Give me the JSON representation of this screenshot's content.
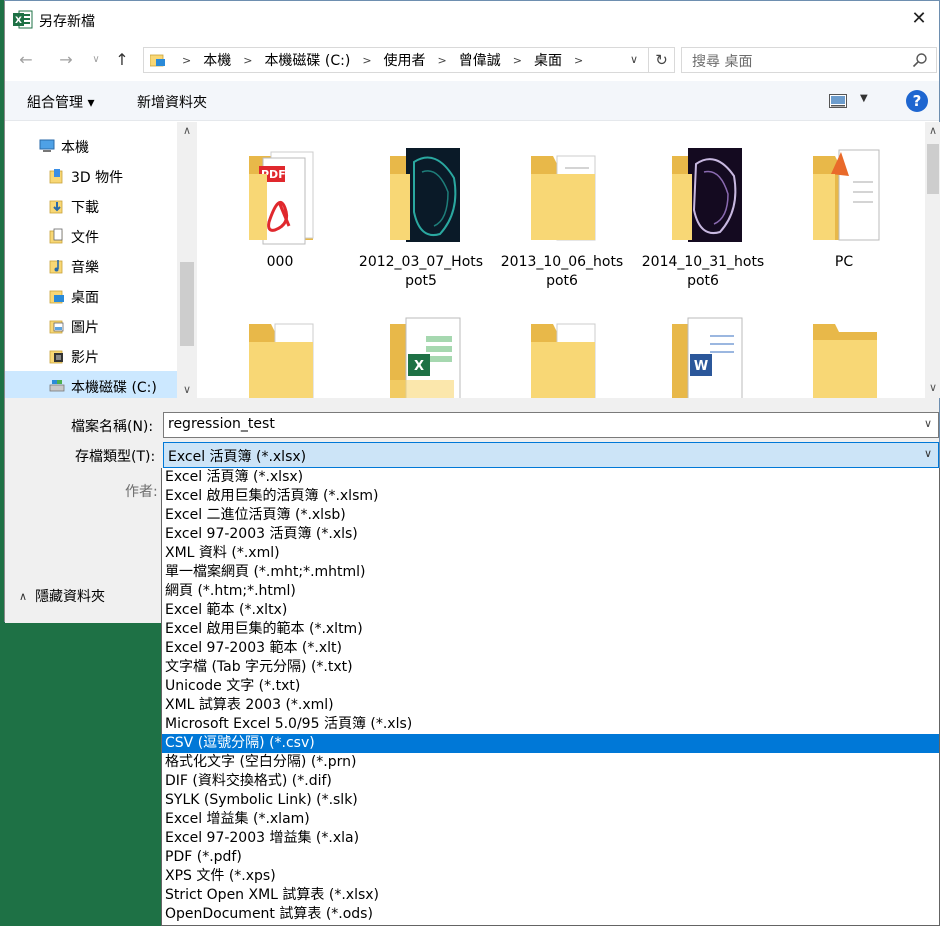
{
  "window": {
    "title": "另存新檔"
  },
  "colors": {
    "accent": "#0078d7",
    "excel_green": "#1e7145",
    "folder": "#f8d775",
    "help_blue": "#1e66d0"
  },
  "address": {
    "crumbs": [
      "本機",
      "本機磁碟 (C:)",
      "使用者",
      "曾偉誠",
      "桌面"
    ],
    "search_placeholder": "搜尋 桌面"
  },
  "toolbar": {
    "organize": "組合管理 ▾",
    "new_folder": "新增資料夾",
    "help": "?"
  },
  "nav": {
    "items": [
      {
        "label": "本機",
        "icon": "computer-icon"
      },
      {
        "label": "3D 物件",
        "icon": "3d-objects-icon"
      },
      {
        "label": "下載",
        "icon": "downloads-icon"
      },
      {
        "label": "文件",
        "icon": "documents-icon"
      },
      {
        "label": "音樂",
        "icon": "music-icon"
      },
      {
        "label": "桌面",
        "icon": "desktop-icon"
      },
      {
        "label": "圖片",
        "icon": "pictures-icon"
      },
      {
        "label": "影片",
        "icon": "videos-icon"
      },
      {
        "label": "本機磁碟 (C:)",
        "icon": "drive-icon"
      }
    ]
  },
  "files": [
    {
      "name": "000",
      "icon": "folder-pdf-icon"
    },
    {
      "name": "2012_03_07_Hotspot5",
      "icon": "folder-image-icon"
    },
    {
      "name": "2013_10_06_hotspot6",
      "icon": "folder-docs-icon"
    },
    {
      "name": "2014_10_31_hotspot6",
      "icon": "folder-image-icon"
    },
    {
      "name": "PC",
      "icon": "folder-pc-icon"
    },
    {
      "name": "",
      "icon": "folder-docs-icon"
    },
    {
      "name": "",
      "icon": "folder-excel-icon"
    },
    {
      "name": "",
      "icon": "folder-docs-icon"
    },
    {
      "name": "",
      "icon": "folder-word-icon"
    },
    {
      "name": "",
      "icon": "folder-icon"
    }
  ],
  "form": {
    "filename_label": "檔案名稱(N):",
    "filename_value": "regression_test",
    "type_label": "存檔類型(T):",
    "type_value": "Excel 活頁簿 (*.xlsx)",
    "author_label": "作者:",
    "hide_folders": "隱藏資料夾"
  },
  "type_options": [
    "Excel 活頁簿 (*.xlsx)",
    "Excel 啟用巨集的活頁簿 (*.xlsm)",
    "Excel 二進位活頁簿 (*.xlsb)",
    "Excel 97-2003 活頁簿 (*.xls)",
    "XML 資料 (*.xml)",
    "單一檔案網頁 (*.mht;*.mhtml)",
    "網頁 (*.htm;*.html)",
    "Excel 範本 (*.xltx)",
    "Excel 啟用巨集的範本 (*.xltm)",
    "Excel 97-2003 範本 (*.xlt)",
    "文字檔 (Tab 字元分隔) (*.txt)",
    "Unicode 文字 (*.txt)",
    "XML 試算表 2003 (*.xml)",
    "Microsoft Excel 5.0/95 活頁簿 (*.xls)",
    "CSV (逗號分隔) (*.csv)",
    "格式化文字 (空白分隔) (*.prn)",
    "DIF (資料交換格式) (*.dif)",
    "SYLK (Symbolic Link) (*.slk)",
    "Excel 增益集 (*.xlam)",
    "Excel 97-2003 增益集 (*.xla)",
    "PDF (*.pdf)",
    "XPS 文件 (*.xps)",
    "Strict Open XML 試算表 (*.xlsx)",
    "OpenDocument 試算表 (*.ods)"
  ],
  "highlighted_option": 14
}
